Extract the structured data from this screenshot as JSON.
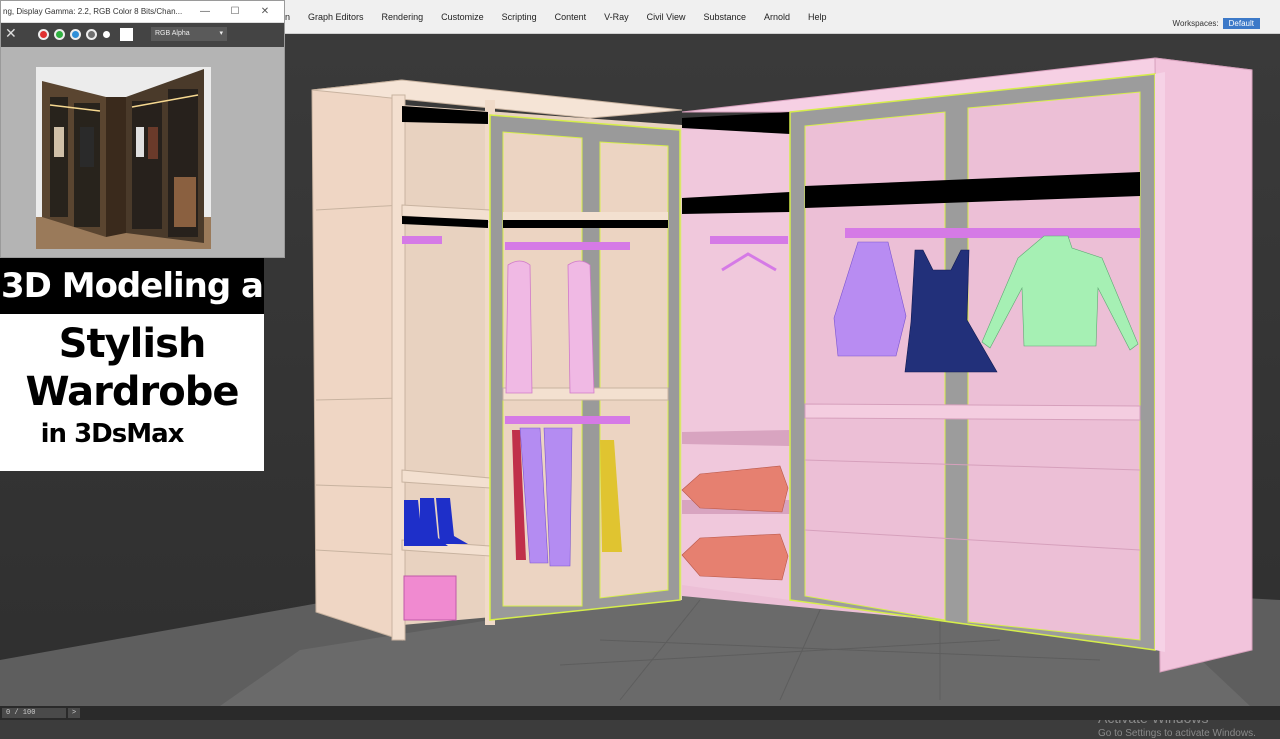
{
  "menu": {
    "items": [
      "n",
      "Graph Editors",
      "Rendering",
      "Customize",
      "Scripting",
      "Content",
      "V-Ray",
      "Civil View",
      "Substance",
      "Arnold",
      "Help"
    ],
    "workspaces_label": "Workspaces:",
    "workspaces_value": "Default"
  },
  "frame_window": {
    "title": "ng, Display Gamma: 2.2, RGB Color 8 Bits/Chan...",
    "channel_select": "RGB Alpha",
    "channel_dots": [
      "#e03030",
      "#30b040",
      "#2f8fd8",
      "#707070",
      "#ffffff"
    ]
  },
  "title_card": {
    "line1": "3D Modeling a",
    "line2": "Stylish",
    "line3": "Wardrobe",
    "line4": "in 3DsMax"
  },
  "status": {
    "frame_counter": "0 / 100",
    "next": ">"
  },
  "watermark": {
    "line1": "Activate Windows",
    "line2": "Go to Settings to activate Windows."
  },
  "colors": {
    "cabinet_beige": "#f1dccb",
    "cabinet_pink": "#f1c6dd",
    "door_frame": "#9c9c9c",
    "selection_outline": "#d6ee4a",
    "garment_purple": "#b88cf2",
    "garment_navy": "#22307a",
    "garment_green": "#a6f0b4",
    "pillow": "#e68070",
    "boots": "#1e2fc9",
    "rod": "#d57ae6",
    "floor": "#6a6a6a"
  }
}
